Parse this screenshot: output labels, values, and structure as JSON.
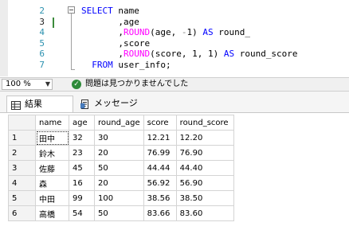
{
  "editor": {
    "lines": [
      {
        "num": "2",
        "parts": [
          {
            "t": "SELECT ",
            "c": "kw"
          },
          {
            "t": "name",
            "c": ""
          }
        ]
      },
      {
        "num": "3",
        "parts": [
          {
            "t": "       ,age",
            "c": ""
          }
        ]
      },
      {
        "num": "4",
        "parts": [
          {
            "t": "       ,",
            "c": ""
          },
          {
            "t": "ROUND",
            "c": "fn"
          },
          {
            "t": "(age, ",
            "c": ""
          },
          {
            "t": "-",
            "c": "gray"
          },
          {
            "t": "1) ",
            "c": ""
          },
          {
            "t": "AS",
            "c": "kw"
          },
          {
            "t": " round_",
            "c": ""
          }
        ]
      },
      {
        "num": "5",
        "parts": [
          {
            "t": "       ,score",
            "c": ""
          }
        ]
      },
      {
        "num": "6",
        "parts": [
          {
            "t": "       ,",
            "c": ""
          },
          {
            "t": "ROUND",
            "c": "fn"
          },
          {
            "t": "(score, 1, 1) ",
            "c": ""
          },
          {
            "t": "AS",
            "c": "kw"
          },
          {
            "t": " round_score",
            "c": ""
          }
        ]
      },
      {
        "num": "7",
        "parts": [
          {
            "t": "  ",
            "c": ""
          },
          {
            "t": "FROM",
            "c": "kw"
          },
          {
            "t": " user_info;",
            "c": ""
          }
        ]
      }
    ],
    "current_line": "3"
  },
  "status": {
    "zoom": "100 %",
    "message": "問題は見つかりませんでした"
  },
  "tabs": {
    "results_label": "結果",
    "messages_label": "メッセージ"
  },
  "grid": {
    "columns": [
      "name",
      "age",
      "round_age",
      "score",
      "round_score"
    ],
    "rows": [
      {
        "n": "1",
        "cells": [
          "田中",
          "32",
          "30",
          "12.21",
          "12.20"
        ]
      },
      {
        "n": "2",
        "cells": [
          "鈴木",
          "23",
          "20",
          "76.99",
          "76.90"
        ]
      },
      {
        "n": "3",
        "cells": [
          "佐藤",
          "45",
          "50",
          "44.44",
          "44.40"
        ]
      },
      {
        "n": "4",
        "cells": [
          "森",
          "16",
          "20",
          "56.92",
          "56.90"
        ]
      },
      {
        "n": "5",
        "cells": [
          "中田",
          "99",
          "100",
          "38.56",
          "38.50"
        ]
      },
      {
        "n": "6",
        "cells": [
          "高橋",
          "54",
          "50",
          "83.66",
          "83.60"
        ]
      }
    ]
  },
  "colors": {
    "keyword": "#0000ff",
    "function": "#ff00ff",
    "line_number": "#2b91af",
    "ok_icon": "#2e8b3a"
  },
  "icons": {
    "ok": "check-circle-icon",
    "results_tab": "grid-icon",
    "messages_tab": "document-icon",
    "zoom_dropdown": "chevron-down-icon"
  }
}
